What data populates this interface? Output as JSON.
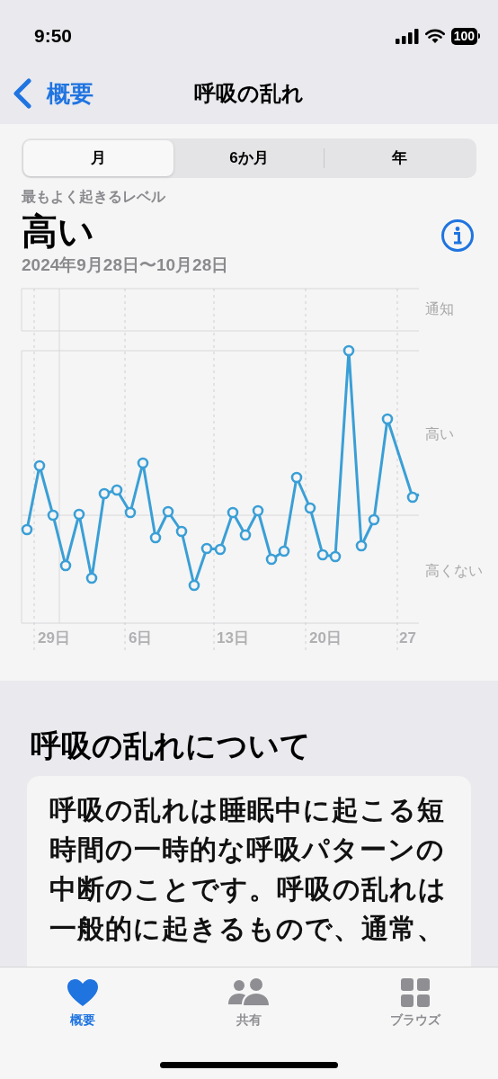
{
  "status_bar": {
    "time": "9:50",
    "battery": "100"
  },
  "nav": {
    "back": "概要",
    "title": "呼吸の乱れ"
  },
  "segments": [
    {
      "label": "月",
      "selected": true
    },
    {
      "label": "6か月",
      "selected": false
    },
    {
      "label": "年",
      "selected": false
    }
  ],
  "summary": {
    "caption": "最もよく起きるレベル",
    "value": "高い",
    "date_range": "2024年9月28日〜10月28日"
  },
  "chart": {
    "y_labels": [
      "通知",
      "高い",
      "高くない"
    ],
    "x_labels": [
      "29日",
      "6日",
      "13日",
      "20日",
      "27"
    ]
  },
  "about": {
    "heading": "呼吸の乱れについて",
    "body": "呼吸の乱れは睡眠中に起こる短時間の一時的な呼吸パターンの中断のことです。呼吸の乱れは一般的に起きるもので、通常、"
  },
  "tab_bar": [
    {
      "label": "概要",
      "selected": true,
      "kind": "heart"
    },
    {
      "label": "共有",
      "selected": false,
      "kind": "people"
    },
    {
      "label": "ブラウズ",
      "selected": false,
      "kind": "grid"
    }
  ]
}
